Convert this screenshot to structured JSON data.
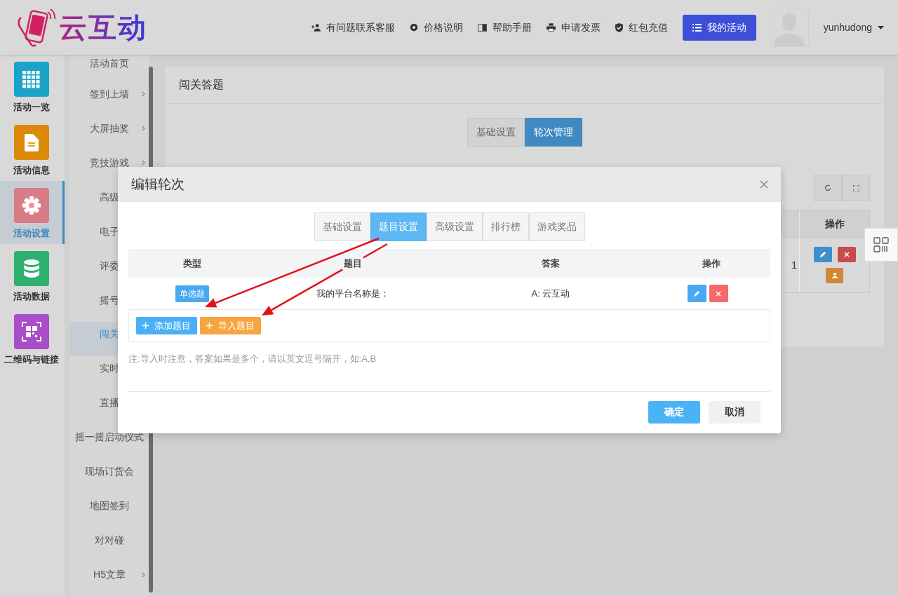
{
  "header": {
    "logo_text": "云互动",
    "links": [
      {
        "label": "有问题联系客服"
      },
      {
        "label": "价格说明"
      },
      {
        "label": "帮助手册"
      },
      {
        "label": "申请发票"
      },
      {
        "label": "红包充值"
      }
    ],
    "primary_button": "我的活动",
    "username": "yunhudong"
  },
  "nav": [
    {
      "label": "活动一览",
      "color": "#18a3c8",
      "selected": false
    },
    {
      "label": "活动信息",
      "color": "#dd8a0a",
      "selected": false
    },
    {
      "label": "活动设置",
      "color": "#d97b86",
      "selected": true
    },
    {
      "label": "活动数据",
      "color": "#2eb06e",
      "selected": false
    },
    {
      "label": "二维码与链接",
      "color": "#a94dc9",
      "selected": false
    }
  ],
  "submenu": [
    {
      "label": "活动首页",
      "has_submenu": false,
      "selected": false
    },
    {
      "label": "签到上墙",
      "has_submenu": true,
      "selected": false
    },
    {
      "label": "大屏抽奖",
      "has_submenu": true,
      "selected": false
    },
    {
      "label": "竞技游戏",
      "has_submenu": true,
      "selected": false
    },
    {
      "label": "高级",
      "has_submenu": false,
      "selected": false
    },
    {
      "label": "电子",
      "has_submenu": false,
      "selected": false
    },
    {
      "label": "评委",
      "has_submenu": false,
      "selected": false
    },
    {
      "label": "摇号",
      "has_submenu": false,
      "selected": false
    },
    {
      "label": "闯关",
      "has_submenu": false,
      "selected": true
    },
    {
      "label": "实时",
      "has_submenu": false,
      "selected": false
    },
    {
      "label": "直播",
      "has_submenu": false,
      "selected": false
    },
    {
      "label": "摇一摇启动仪式",
      "has_submenu": false,
      "selected": false
    },
    {
      "label": "现场订货会",
      "has_submenu": false,
      "selected": false
    },
    {
      "label": "地图签到",
      "has_submenu": false,
      "selected": false
    },
    {
      "label": "对对碰",
      "has_submenu": false,
      "selected": false
    },
    {
      "label": "H5文章",
      "has_submenu": true,
      "selected": false
    }
  ],
  "page": {
    "title": "闯关答题",
    "tabs": [
      {
        "label": "基础设置",
        "selected": false
      },
      {
        "label": "轮次管理",
        "selected": true
      }
    ],
    "toolbar": [
      {
        "kind": "refresh"
      },
      {
        "kind": "fullscreen"
      }
    ],
    "table": {
      "column_header": "操作",
      "row_text": "1",
      "actions": [
        {
          "kind": "edit"
        },
        {
          "kind": "delete"
        },
        {
          "kind": "user"
        }
      ]
    }
  },
  "modal": {
    "title": "编辑轮次",
    "tabs": [
      {
        "label": "基础设置",
        "selected": false
      },
      {
        "label": "题目设置",
        "selected": true
      },
      {
        "label": "高级设置",
        "selected": false
      },
      {
        "label": "排行榜",
        "selected": false
      },
      {
        "label": "游戏奖品",
        "selected": false
      }
    ],
    "columns": [
      "类型",
      "题目",
      "答案",
      "操作"
    ],
    "rows": [
      {
        "type": "单选题",
        "question": "我的平台名称是：",
        "answer": "A: 云互动"
      }
    ],
    "add_button": "添加题目",
    "import_button": "导入题目",
    "note": "注:导入时注意，答案如果是多个，请以英文逗号隔开，如:A,B",
    "confirm": "确定",
    "cancel": "取消"
  }
}
